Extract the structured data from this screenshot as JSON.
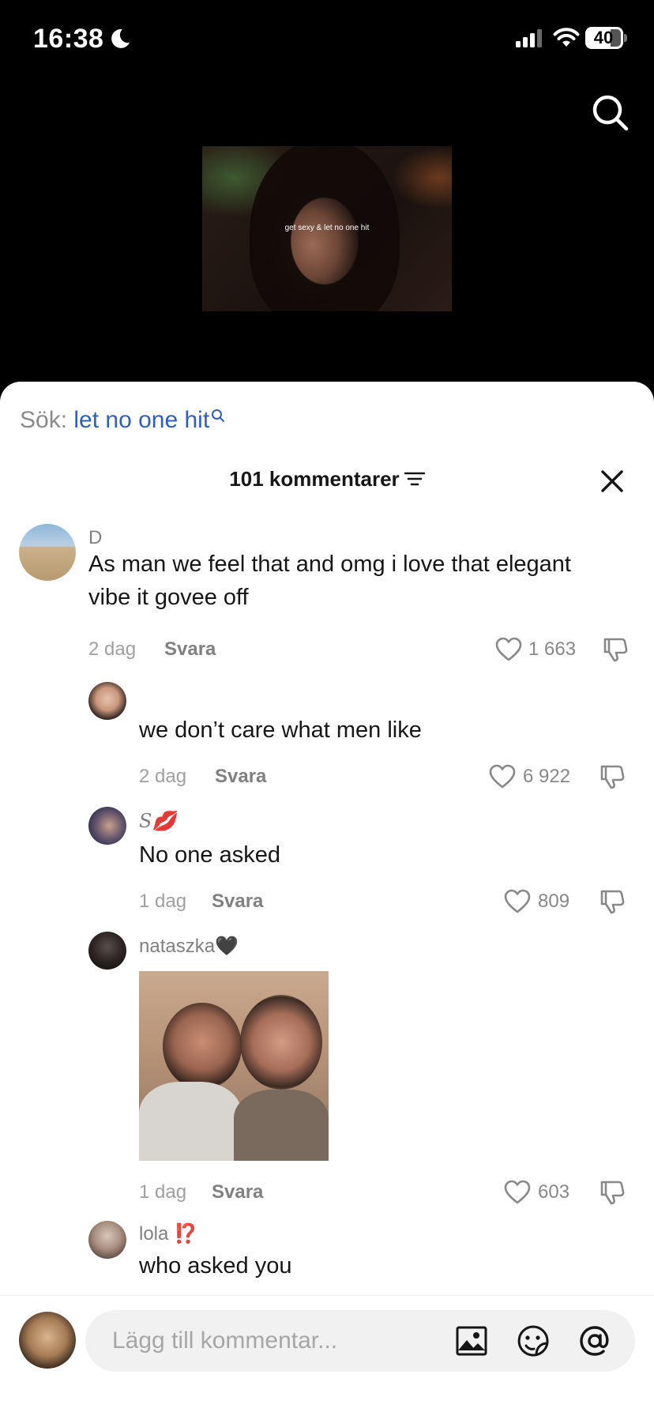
{
  "status_bar": {
    "time": "16:38",
    "battery": "40"
  },
  "video": {
    "caption": "get sexy & let no one hit"
  },
  "search_hint": {
    "prefix": "Sök:",
    "term": "let no one hit"
  },
  "header": {
    "title": "101 kommentarer"
  },
  "comments": [
    {
      "author": "D",
      "text_line1": "As man we feel that and omg i love that elegant",
      "text_line2": "vibe it govee off",
      "age": "2 dag",
      "reply": "Svara",
      "likes": "1 663"
    },
    {
      "author": "",
      "text": "we don’t care what men like",
      "age": "2 dag",
      "reply": "Svara",
      "likes": "6 922"
    },
    {
      "author": "S💋",
      "text": "No one asked",
      "age": "1 dag",
      "reply": "Svara",
      "likes": "809"
    },
    {
      "author": "nataszka🖤",
      "age": "1 dag",
      "reply": "Svara",
      "likes": "603"
    },
    {
      "author": "lola ⁉️",
      "text": "who asked you"
    }
  ],
  "composer": {
    "placeholder": "Lägg till kommentar..."
  },
  "icons": [
    "moon-icon",
    "cellular-signal-icon",
    "wifi-icon",
    "battery-icon",
    "search-icon",
    "filter-icon",
    "close-icon",
    "heart-icon",
    "dislike-icon",
    "image-icon",
    "emoji-sticker-icon",
    "mention-icon"
  ]
}
